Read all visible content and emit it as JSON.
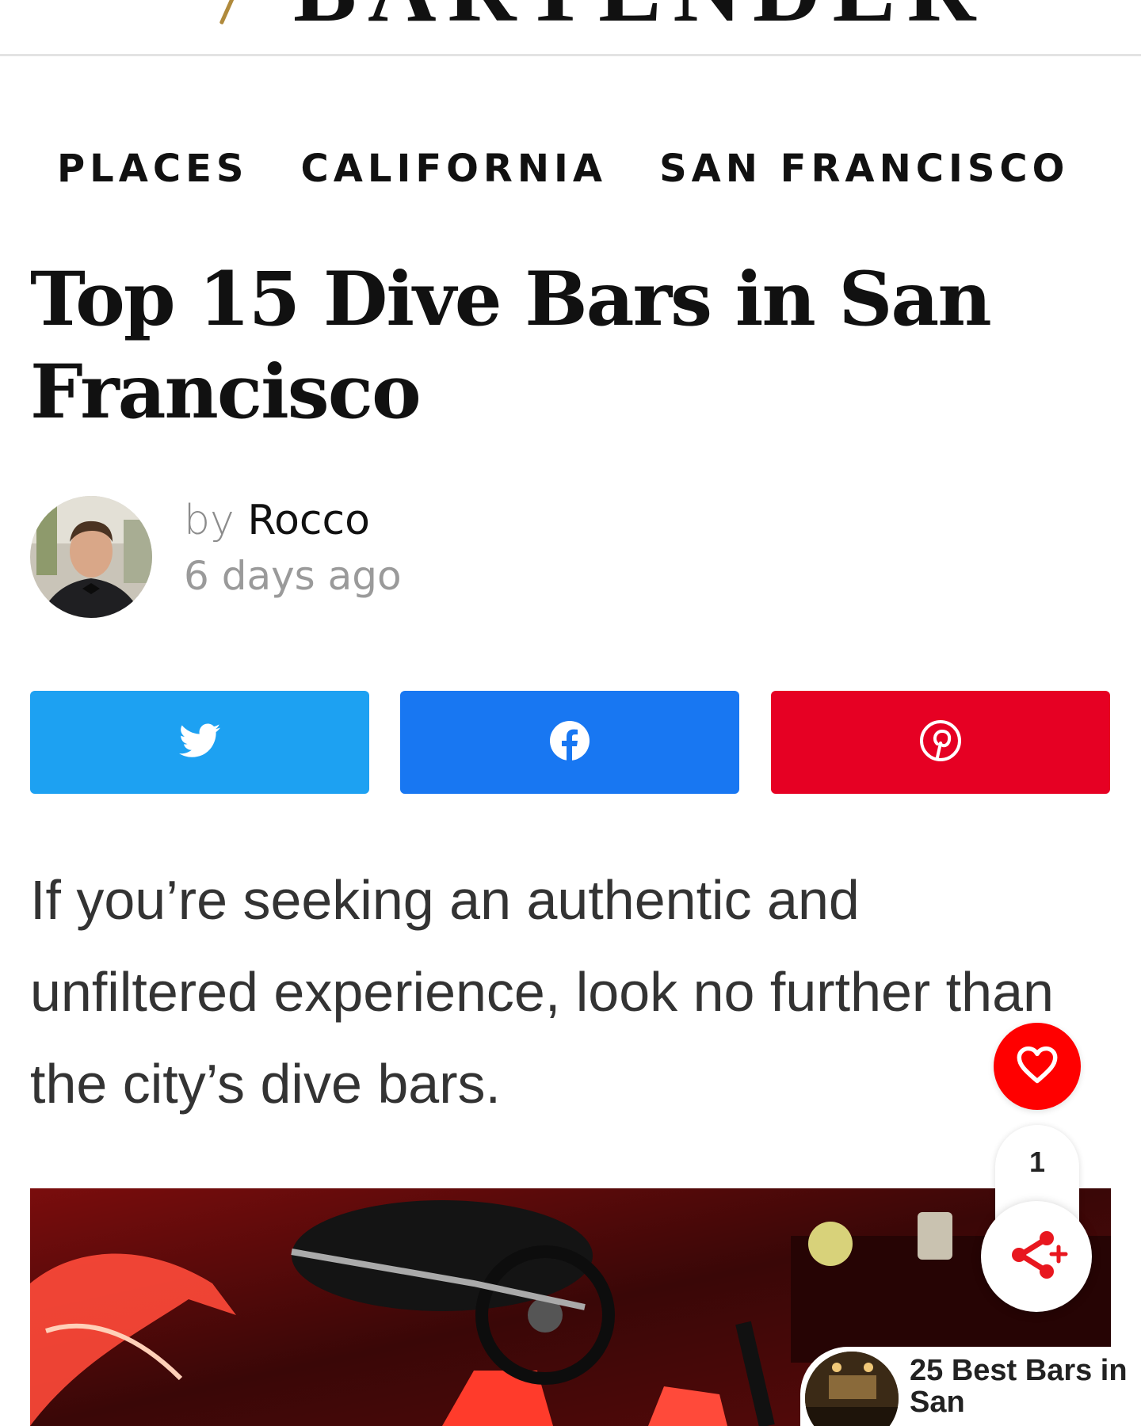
{
  "site": {
    "logo_text": "BARTENDER"
  },
  "breadcrumb": [
    "PLACES",
    "CALIFORNIA",
    "SAN FRANCISCO"
  ],
  "article": {
    "title": "Top 15 Dive Bars in San Francisco",
    "byline_prefix": "by",
    "author": "Rocco",
    "posted": "6 days ago",
    "intro": "If you’re seeking an authentic and unfiltered experience, look no further than the city’s dive bars."
  },
  "share": [
    {
      "network": "twitter",
      "icon": "twitter-bird-icon",
      "color": "#1da1f2"
    },
    {
      "network": "facebook",
      "icon": "facebook-f-icon",
      "color": "#1877f2"
    },
    {
      "network": "pinterest",
      "icon": "pinterest-p-icon",
      "color": "#e60023"
    }
  ],
  "floating": {
    "like_count": "1",
    "like_color": "#ff0000",
    "share_color": "#e8171f"
  },
  "related": {
    "title": "25 Best Bars in San"
  },
  "colors": {
    "text": "#111111",
    "muted": "#9a9a9a",
    "divider": "#e3e3e3",
    "gold": "#b08a3c"
  }
}
